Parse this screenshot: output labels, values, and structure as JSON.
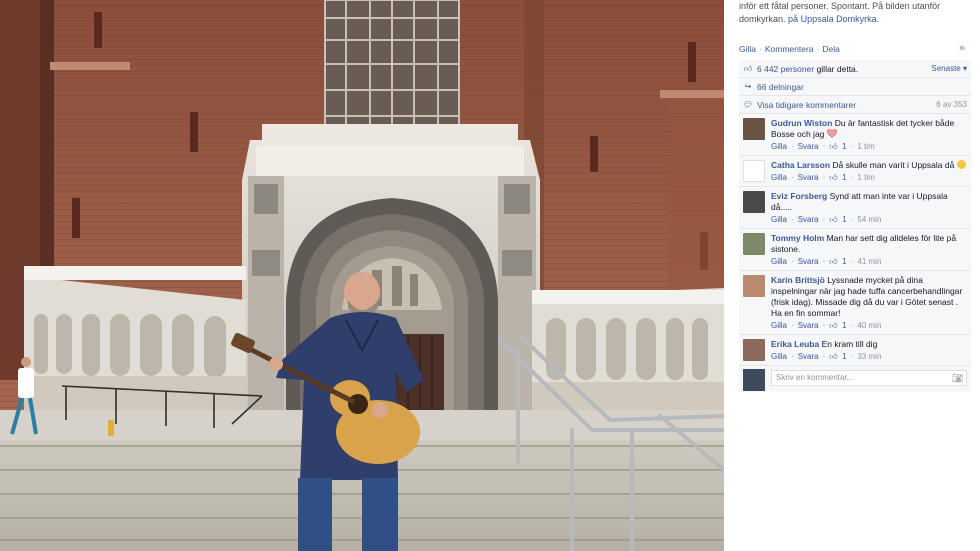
{
  "caption": {
    "line1": "inför ett fåtal personer. Spontant. På bilden utanför",
    "line2_prefix": "domkyrkan.",
    "location_prefix": "på",
    "location": "Uppsala Domkyrka."
  },
  "actions": {
    "like": "Gilla",
    "comment": "Kommentera",
    "share": "Dela"
  },
  "likes": {
    "count_link": "6 442 personer",
    "text": "gillar detta.",
    "sort": "Senaste"
  },
  "shares": {
    "text": "66 delningar"
  },
  "previous": {
    "text": "Visa tidigare kommentarer",
    "count": "6 av 353"
  },
  "comments": [
    {
      "author": "Gudrun Wiston",
      "text": "Du är fantastisk det tycker både Bosse och jag",
      "likes": "1",
      "time": "1 tim"
    },
    {
      "author": "Catha Larsson",
      "text": "Då skulle man varit i Uppsala då",
      "likes": "1",
      "time": "1 tim"
    },
    {
      "author": "Eviz Forsberg",
      "text": "Synd att man inte var i Uppsala då.....",
      "likes": "1",
      "time": "54 min"
    },
    {
      "author": "Tommy Holm",
      "text": "Man har sett dig alldeles för lite på sistone.",
      "likes": "1",
      "time": "41 min"
    },
    {
      "author": "Karin Brittsjö",
      "text": "Lyssnade mycket på dina inspelningar när jag hade tuffa cancerbehandlingar (frisk idag). Missade dig då du var i Götet senast . Ha en fin sommar!",
      "likes": "1",
      "time": "40 min"
    },
    {
      "author": "Erika Leuba",
      "text": "En kram till dig",
      "likes": "1",
      "time": "33 min"
    }
  ],
  "comment_meta": {
    "like": "Gilla",
    "reply": "Svara"
  },
  "composer": {
    "placeholder": "Skriv en kommentar..."
  },
  "colors": {
    "link": "#3b5998",
    "panel_bg": "#f6f7f9",
    "muted": "#90949c"
  },
  "icons": [
    "thumbs-up-icon",
    "share-icon",
    "comment-bubble-icon",
    "flag-icon",
    "camera-icon",
    "heart-icon",
    "smiley-icon",
    "chevron-down-icon"
  ]
}
